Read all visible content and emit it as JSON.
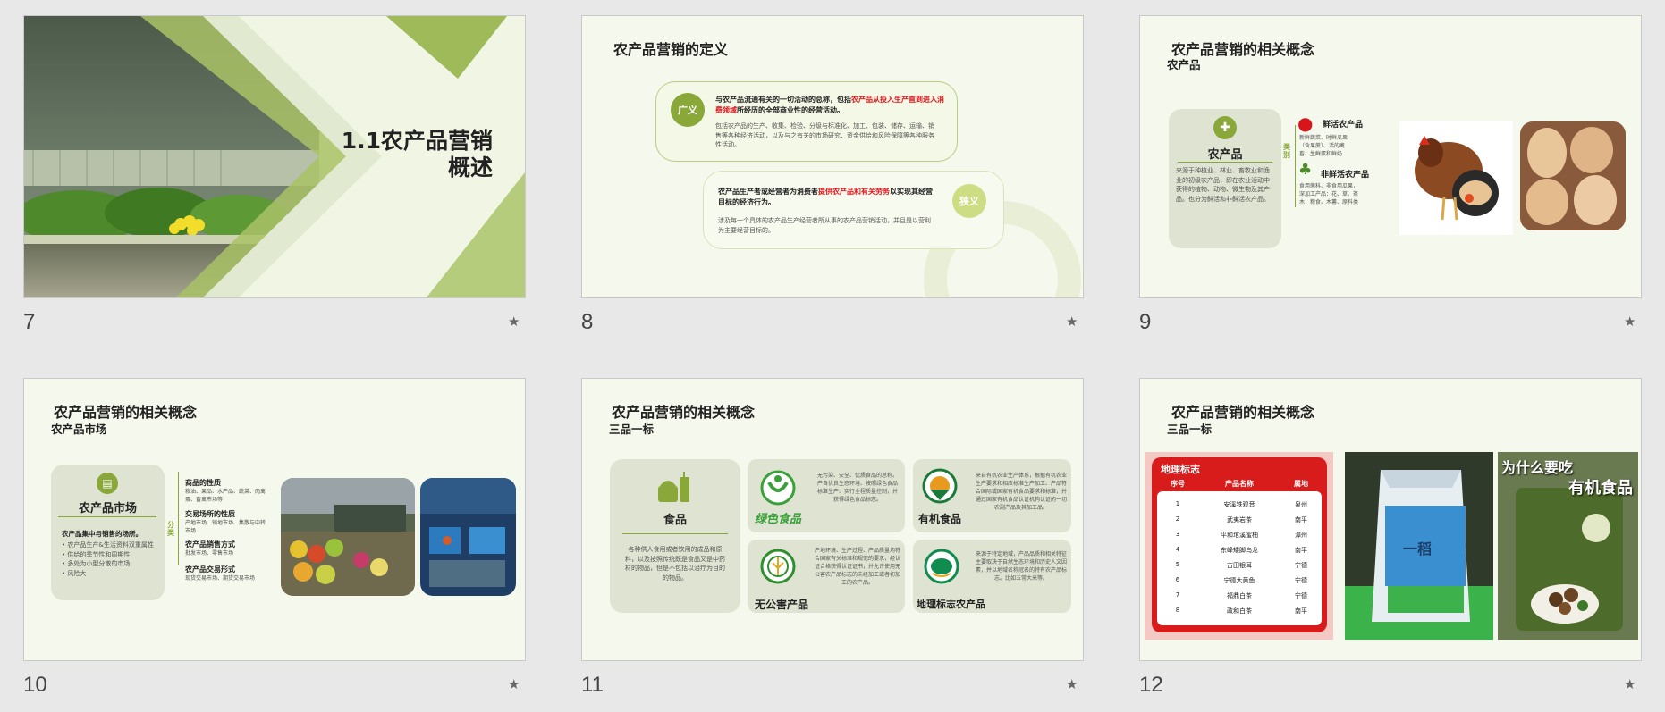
{
  "slides": [
    {
      "number": "7",
      "title": "1.1农产品营销",
      "title2": "概述"
    },
    {
      "number": "8",
      "title": "农产品营销的定义",
      "broad": {
        "badge": "广义",
        "lead1": "与农产品流通有关的一切活动的总称，包括",
        "lead_red": "农产品从投入生产直到进入消费领域",
        "lead2": "所经历的全部商业性的经营活动。",
        "detail": "包括农产品的生产、收集、检验、分级与标准化、加工、包装、储存、运输、销售等各种经济活动，以及与之有关的市场研究、资金供给和风险保障等各种服务性活动。"
      },
      "narrow": {
        "badge": "狭义",
        "lead1": "农产品生产者或经营者为消费者",
        "lead_red": "提供农产品和有关劳务",
        "lead2": "以实现其经营目标的经济行为。",
        "detail": "涉及每一个具体的农产品生产经营者所从事的农产品营销活动，并且是以营利为主要经营目标的。"
      }
    },
    {
      "number": "9",
      "title": "农产品营销的相关概念",
      "subtitle": "农产品",
      "card_title": "农产品",
      "card_text": "来源于种植业、林业、畜牧业和渔业的初级农产品，即在农业活动中获得的植物、动物、微生物及其产品。也分为鲜活和非鲜活农产品。",
      "category_label": "类别",
      "fresh": {
        "label": "鲜活农产品",
        "text": "新鲜蔬菜、时鲜瓜果（含果蔗）、活的禽畜、生鲜蛋和鲜奶"
      },
      "nonfresh": {
        "label": "非鲜活农产品",
        "text": "食用菌科、非食用瓜果，深加工产品：花、草、茶木，粮食、木薯、原料类"
      }
    },
    {
      "number": "10",
      "title": "农产品营销的相关概念",
      "subtitle": "农产品市场",
      "card_title": "农产品市场",
      "card_lead": "农产品集中与销售的场所。",
      "card_bullets": [
        "农产品生产&生活资料双重属性",
        "供给的季节性和周期性",
        "多处为小型分散的市场",
        "风险大"
      ],
      "category_label": "分类",
      "categories": [
        {
          "label": "商品的性质",
          "text": "粮油、果品、水产品、蔬菜、肉禽蛋、畜禽市场等"
        },
        {
          "label": "交易场所的性质",
          "text": "产地市场、销地市场、集散与中转市场"
        },
        {
          "label": "农产品销售方式",
          "text": "批发市场、零售市场"
        },
        {
          "label": "农产品交易形式",
          "text": "现货交易市场、期货交易市场"
        }
      ]
    },
    {
      "number": "11",
      "title": "农产品营销的相关概念",
      "subtitle": "三品一标",
      "food": {
        "label": "食品",
        "text": "各种供人食用或者饮用的成品和原料，以及按照传统既是食品又是中药材的物品，但是不包括以治疗为目的的物品。"
      },
      "items": [
        {
          "label": "绿色食品",
          "text": "无污染、安全、优质食品的总称。产自优良生态环境、按照绿色食品标准生产、实行全程质量控制，并获得绿色食品标志。"
        },
        {
          "label": "有机食品",
          "text": "来自有机农业生产体系，根据有机农业生产要求和相应标准生产加工、产品符合国际或国家有机食品要求和标准，并通过国家有机食品认证机构认证的一切农副产品及其加工品。"
        },
        {
          "label": "无公害产品",
          "text": "产地环境、生产过程、产品质量均符合国家有关标准和规范的要求，经认证合格获得认证证书，并允许使用无公害农产品标志的未经加工或者初加工的农产品。"
        },
        {
          "label": "地理标志农产品",
          "text": "来源于特定地域，产品品质和相关特征主要取决于自然生态环境和历史人文因素，并以地域名称冠名的特有农产品标志。比如五常大米等。"
        }
      ]
    },
    {
      "number": "12",
      "title": "农产品营销的相关概念",
      "subtitle": "三品一标",
      "table": {
        "heading": "地理标志",
        "headers": [
          "序号",
          "产品名称",
          "属地"
        ],
        "rows": [
          [
            "1",
            "安溪铁观音",
            "泉州"
          ],
          [
            "2",
            "武夷岩茶",
            "南平"
          ],
          [
            "3",
            "平和琯溪蜜柚",
            "漳州"
          ],
          [
            "4",
            "东峰矮脚乌龙",
            "南平"
          ],
          [
            "5",
            "古田银耳",
            "宁德"
          ],
          [
            "6",
            "宁德大黄鱼",
            "宁德"
          ],
          [
            "7",
            "福鼎白茶",
            "宁德"
          ],
          [
            "8",
            "政和白茶",
            "南平"
          ]
        ]
      },
      "rice_text": "一稻",
      "banner1": "为什么要吃",
      "banner2": "有机食品"
    }
  ],
  "colors": {
    "accent": "#8aa83a",
    "light": "#f5f8ec",
    "red": "#e0141b"
  }
}
